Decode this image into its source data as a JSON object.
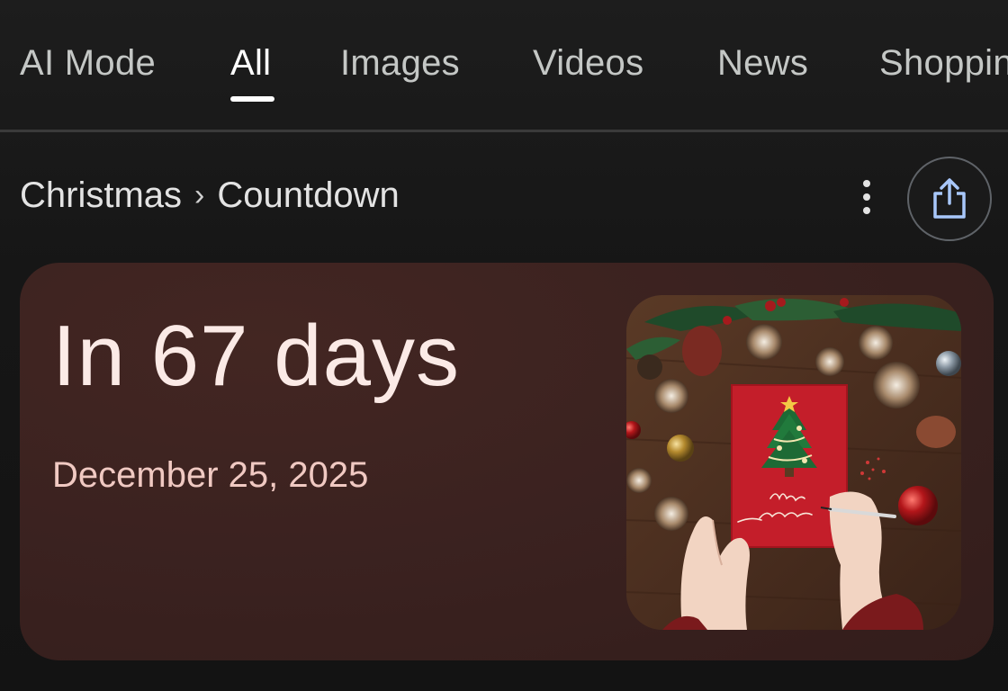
{
  "tabs": [
    {
      "label": "AI Mode",
      "active": false
    },
    {
      "label": "All",
      "active": true
    },
    {
      "label": "Images",
      "active": false
    },
    {
      "label": "Videos",
      "active": false
    },
    {
      "label": "News",
      "active": false
    },
    {
      "label": "Shoppin",
      "active": false
    }
  ],
  "breadcrumb": {
    "parent": "Christmas",
    "separator": "›",
    "current": "Countdown"
  },
  "actions": {
    "more_icon": "more-vert-icon",
    "share_icon": "share-icon"
  },
  "card": {
    "countdown": "In 67 days",
    "date": "December 25, 2025",
    "image_subject": "christmas-card-photo"
  },
  "colors": {
    "background": "#151515",
    "card_bg": "#3b2220",
    "countdown_text": "#fbeae6",
    "date_text": "#f0c9c2",
    "share_icon": "#a8c7fa"
  }
}
